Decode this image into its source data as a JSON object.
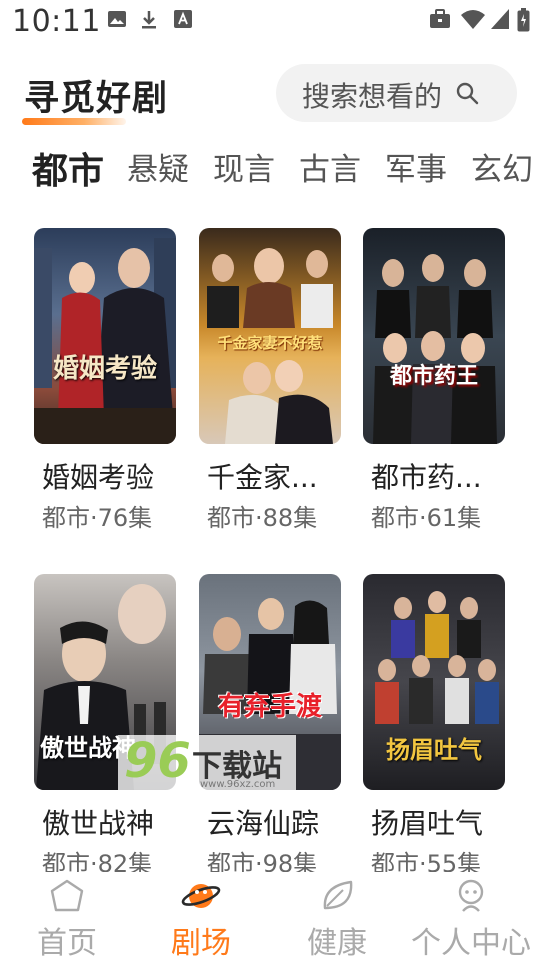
{
  "status_bar": {
    "time": "10:11"
  },
  "header": {
    "title": "寻觅好剧",
    "search_placeholder": "搜索想看的"
  },
  "tabs": [
    {
      "label": "都市",
      "active": true
    },
    {
      "label": "悬疑",
      "active": false
    },
    {
      "label": "现言",
      "active": false
    },
    {
      "label": "古言",
      "active": false
    },
    {
      "label": "军事",
      "active": false
    },
    {
      "label": "玄幻",
      "active": false
    }
  ],
  "dramas": [
    {
      "title": "婚姻考验",
      "meta": "都市·76集",
      "poster_text": "婚姻考验"
    },
    {
      "title": "千金家...",
      "meta": "都市·88集",
      "poster_text": "千金家妻不好惹"
    },
    {
      "title": "都市药...",
      "meta": "都市·61集",
      "poster_text": "都市药王"
    },
    {
      "title": "傲世战神",
      "meta": "都市·82集",
      "poster_text": "傲世战神"
    },
    {
      "title": "云海仙踪",
      "meta": "都市·98集",
      "poster_text": "有弃手渡"
    },
    {
      "title": "扬眉吐气",
      "meta": "都市·55集",
      "poster_text": "扬眉吐气"
    }
  ],
  "watermark": {
    "number": "96",
    "text": "下载站",
    "site": "www.96xz.com"
  },
  "bottom_nav": [
    {
      "label": "首页",
      "icon": "home-icon",
      "active": false
    },
    {
      "label": "剧场",
      "icon": "planet-icon",
      "active": true
    },
    {
      "label": "健康",
      "icon": "leaf-icon",
      "active": false
    },
    {
      "label": "个人中心",
      "icon": "user-icon",
      "active": false
    }
  ],
  "colors": {
    "accent": "#ff7a1a",
    "inactive_nav": "#aaaaaa",
    "search_bg": "#f2f2f2"
  }
}
